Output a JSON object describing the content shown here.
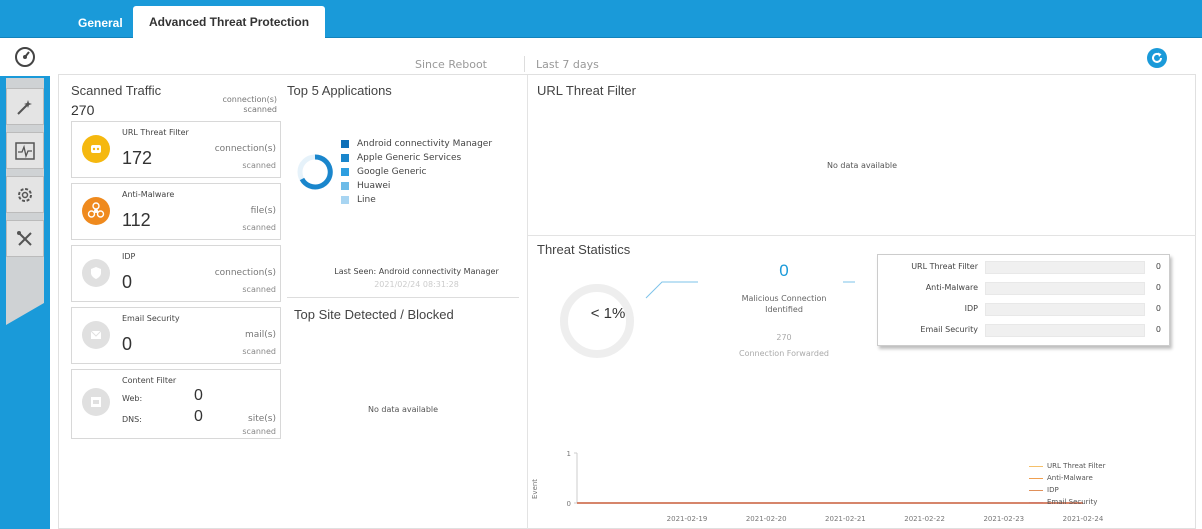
{
  "tabs": [
    {
      "label": "General",
      "active": false
    },
    {
      "label": "Advanced Threat Protection",
      "active": true
    }
  ],
  "sidebar": {
    "items": [
      {
        "icon": "dashboard-icon"
      },
      {
        "icon": "wand-icon"
      },
      {
        "icon": "monitor-icon"
      },
      {
        "icon": "gear-icon"
      },
      {
        "icon": "tools-icon"
      }
    ]
  },
  "header": {
    "since_reboot": "Since Reboot",
    "last_7_days": "Last 7 days",
    "refresh_icon": "refresh-icon"
  },
  "scanned": {
    "title": "Scanned Traffic",
    "value": "270",
    "unit_line1": "connection(s)",
    "unit_line2": "scanned",
    "items": [
      {
        "name": "URL Threat Filter",
        "value": "172",
        "unit": "connection(s)",
        "unit2": "scanned",
        "color": "#f5b80f",
        "icon": "url-filter-icon"
      },
      {
        "name": "Anti-Malware",
        "value": "112",
        "unit": "file(s)",
        "unit2": "scanned",
        "color": "#ef8a1e",
        "icon": "biohazard-icon"
      },
      {
        "name": "IDP",
        "value": "0",
        "unit": "connection(s)",
        "unit2": "scanned",
        "color": "#e0e0e0",
        "icon": "shield-icon"
      },
      {
        "name": "Email Security",
        "value": "0",
        "unit": "mail(s)",
        "unit2": "scanned",
        "color": "#e0e0e0",
        "icon": "mail-icon"
      }
    ],
    "content_filter": {
      "name": "Content Filter",
      "web_label": "Web:",
      "web_value": "0",
      "dns_label": "DNS:",
      "dns_value": "0",
      "unit": "site(s)",
      "unit2": "scanned"
    }
  },
  "top5": {
    "title": "Top 5 Applications",
    "legend": [
      {
        "label": "Android connectivity Manager",
        "color": "#0d6fb8"
      },
      {
        "label": "Apple Generic Services",
        "color": "#1a86cc"
      },
      {
        "label": "Google Generic",
        "color": "#2d9ee0"
      },
      {
        "label": "Huawei",
        "color": "#6cbbe8"
      },
      {
        "label": "Line",
        "color": "#a8d5f2"
      }
    ],
    "last_seen": "Last Seen: Android connectivity Manager",
    "last_seen_date": "2021/02/24 08:31:28"
  },
  "top_site": {
    "title": "Top Site Detected / Blocked",
    "nodata": "No data available"
  },
  "url_filter": {
    "title": "URL Threat Filter",
    "nodata": "No data available"
  },
  "threat_stats": {
    "title": "Threat Statistics",
    "percent": "< 1%",
    "malicious_count": "0",
    "malicious_label1": "Malicious Connection",
    "malicious_label2": "Identified",
    "forwarded_count": "270",
    "forwarded_label": "Connection Forwarded",
    "table": [
      {
        "label": "URL Threat Filter",
        "value": "0"
      },
      {
        "label": "Anti-Malware",
        "value": "0"
      },
      {
        "label": "IDP",
        "value": "0"
      },
      {
        "label": "Email Security",
        "value": "0"
      }
    ]
  },
  "chart_data": {
    "type": "line",
    "x": [
      "2021-02-19",
      "2021-02-20",
      "2021-02-21",
      "2021-02-22",
      "2021-02-23",
      "2021-02-24"
    ],
    "ylabel": "Event",
    "ylim": [
      0,
      1
    ],
    "yticks": [
      "1",
      "0"
    ],
    "series": [
      {
        "name": "URL Threat Filter",
        "values": [
          0,
          0,
          0,
          0,
          0,
          0
        ],
        "color": "#f5c06a"
      },
      {
        "name": "Anti-Malware",
        "values": [
          0,
          0,
          0,
          0,
          0,
          0
        ],
        "color": "#f0a050"
      },
      {
        "name": "IDP",
        "values": [
          0,
          0,
          0,
          0,
          0,
          0
        ],
        "color": "#e0905a"
      },
      {
        "name": "Email Security",
        "values": [
          0,
          0,
          0,
          0,
          0,
          0
        ],
        "color": "#d07a6a"
      }
    ]
  }
}
